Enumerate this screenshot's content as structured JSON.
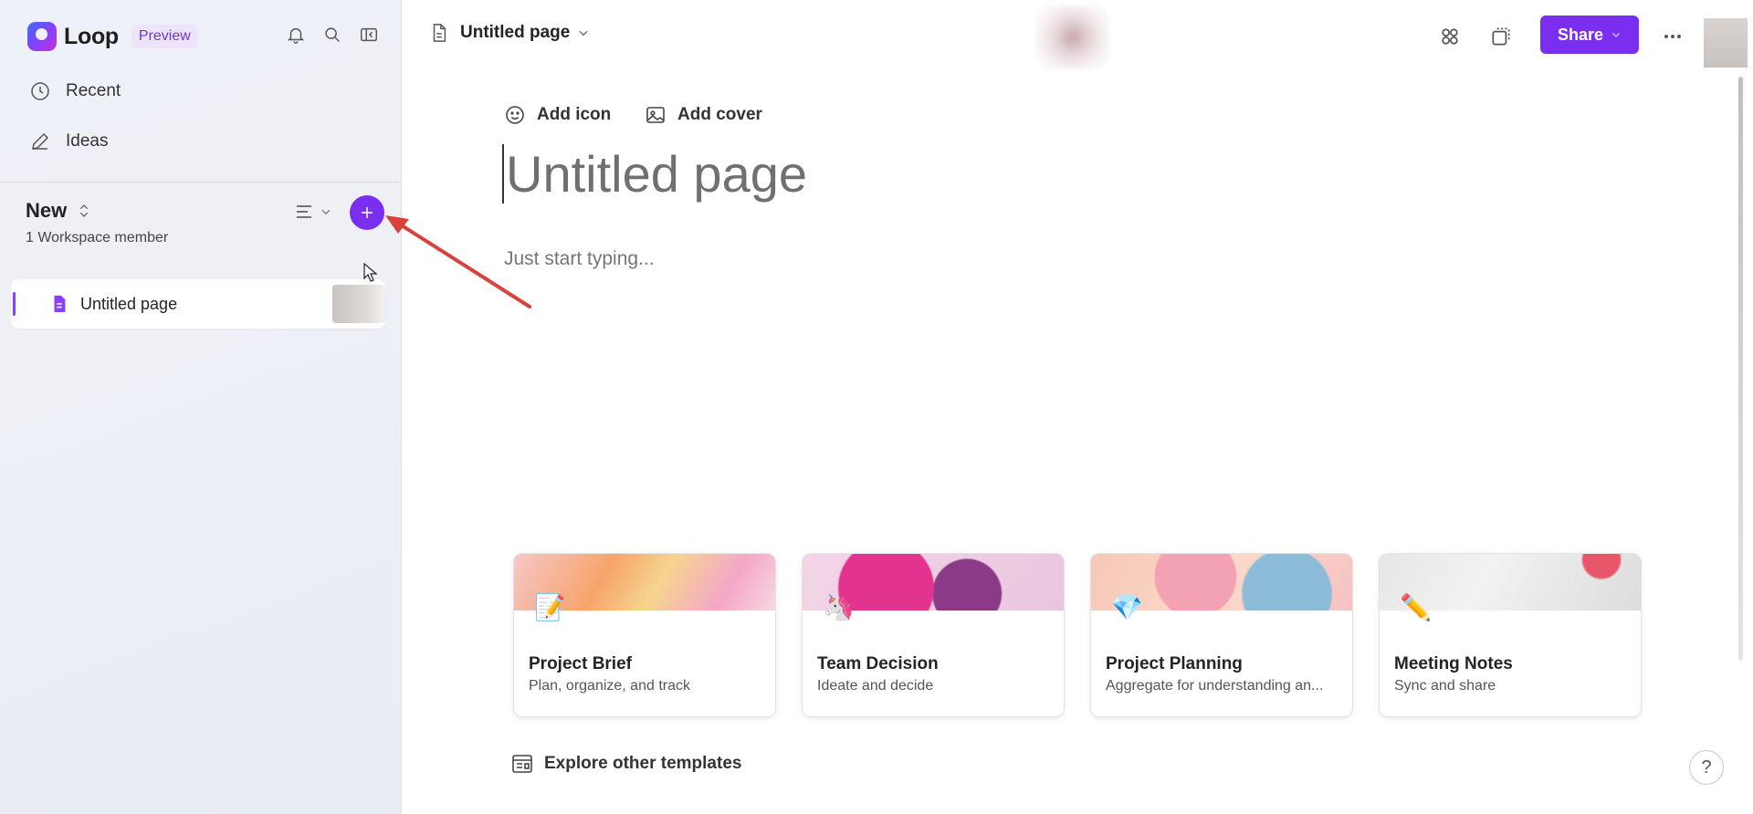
{
  "app": {
    "name": "Loop",
    "badge": "Preview"
  },
  "sidebar": {
    "nav": [
      {
        "label": "Recent",
        "icon": "clock-icon"
      },
      {
        "label": "Ideas",
        "icon": "pencil-icon"
      }
    ],
    "workspace": {
      "name": "New",
      "members": "1 Workspace member"
    },
    "pages": [
      {
        "label": "Untitled page",
        "active": true
      }
    ]
  },
  "topbar": {
    "page_title": "Untitled page",
    "share_label": "Share"
  },
  "editor": {
    "add_icon": "Add icon",
    "add_cover": "Add cover",
    "title_placeholder": "Untitled page",
    "body_placeholder": "Just start typing..."
  },
  "templates": [
    {
      "title": "Project Brief",
      "subtitle": "Plan, organize, and track",
      "emoji": "📝"
    },
    {
      "title": "Team Decision",
      "subtitle": "Ideate and decide",
      "emoji": "🦄"
    },
    {
      "title": "Project Planning",
      "subtitle": "Aggregate for understanding an...",
      "emoji": "💎"
    },
    {
      "title": "Meeting Notes",
      "subtitle": "Sync and share",
      "emoji": "✏️"
    }
  ],
  "explore_label": "Explore other templates",
  "help_label": "?",
  "colors": {
    "accent": "#7a2ff0",
    "annotation_arrow": "#d9413c"
  }
}
